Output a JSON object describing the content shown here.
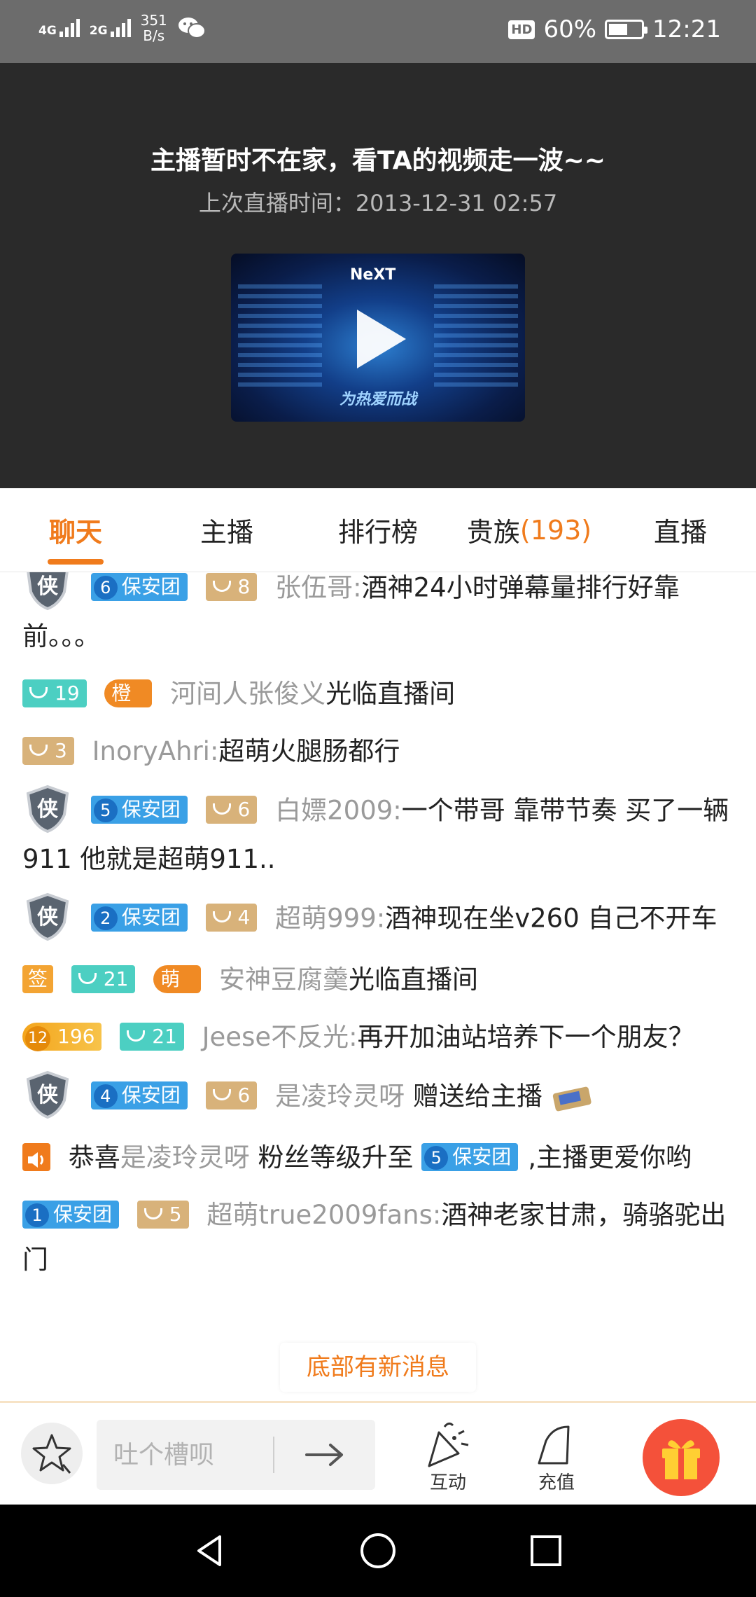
{
  "status_bar": {
    "net1": "4G",
    "net2": "2G",
    "speed_value": "351",
    "speed_unit": "B/s",
    "hd": "HD",
    "battery": "60%",
    "time": "12:21",
    "battery_level": 0.6
  },
  "video": {
    "offline_title": "主播暂时不在家，看TA的视频走一波~~",
    "last_live": "上次直播时间：2013-12-31  02:57",
    "thumb_logo": "NeXT",
    "thumb_slogan": "为热爱而战"
  },
  "tabs": [
    {
      "label": "聊天",
      "active": true
    },
    {
      "label": "主播"
    },
    {
      "label": "排行榜"
    },
    {
      "label": "贵族",
      "count": "(193)"
    },
    {
      "label": "直播"
    }
  ],
  "chat": [
    {
      "fan_level": "6",
      "fan_group": "保安团",
      "wealth": "8",
      "nick": "张伍哥:",
      "text": "酒神24小时弹幕量排行好靠前。。。"
    },
    {
      "wealth_hi": "19",
      "honor": "橙",
      "nick": "河间人张俊义",
      "text": "光临直播间"
    },
    {
      "wealth": "3",
      "nick": "InoryAhri:",
      "text": "超萌火腿肠都行"
    },
    {
      "fan_level": "5",
      "fan_group": "保安团",
      "wealth": "6",
      "nick": "白嫖2009:",
      "text": "一个带哥 靠带节奏 买了一辆911 他就是超萌911.."
    },
    {
      "fan_level": "2",
      "fan_group": "保安团",
      "wealth": "4",
      "nick": "超萌999:",
      "text": "酒神现在坐v260 自己不开车"
    },
    {
      "sign": "签",
      "wealth_hi": "21",
      "honor": "萌",
      "nick": "安神豆腐羹",
      "text": "光临直播间"
    },
    {
      "level": "12",
      "level_value": "196",
      "wealth_hi": "21",
      "nick": "Jeese不反光:",
      "text": "再开加油站培养下一个朋友？"
    },
    {
      "fan_level": "4",
      "fan_group": "保安团",
      "wealth": "6",
      "nick": "是凌玲灵呀",
      "text": " 赠送给主播"
    },
    {
      "sys_prefix": "恭喜",
      "nick": "是凌玲灵呀",
      "sys_mid": " 粉丝等级升至",
      "fan_level": "5",
      "fan_group": "保安团",
      "text": ",主播更爱你哟"
    },
    {
      "fan_level": "1",
      "fan_group": "保安团",
      "wealth": "5",
      "nick": "超萌true2009fans:",
      "text": "酒神老家甘肃，骑骆驼出门"
    }
  ],
  "shield_char": "侠",
  "new_message_tip": "底部有新消息",
  "bottom_bar": {
    "input_placeholder": "吐个槽呗",
    "interact_label": "互动",
    "recharge_label": "充值"
  },
  "colors": {
    "accent": "#f07b1c",
    "fan_badge": "#3aa0e6",
    "wealth_badge": "#d8b27a",
    "wealth_hi_badge": "#4ccfc2",
    "gift_button": "#f4513a"
  }
}
